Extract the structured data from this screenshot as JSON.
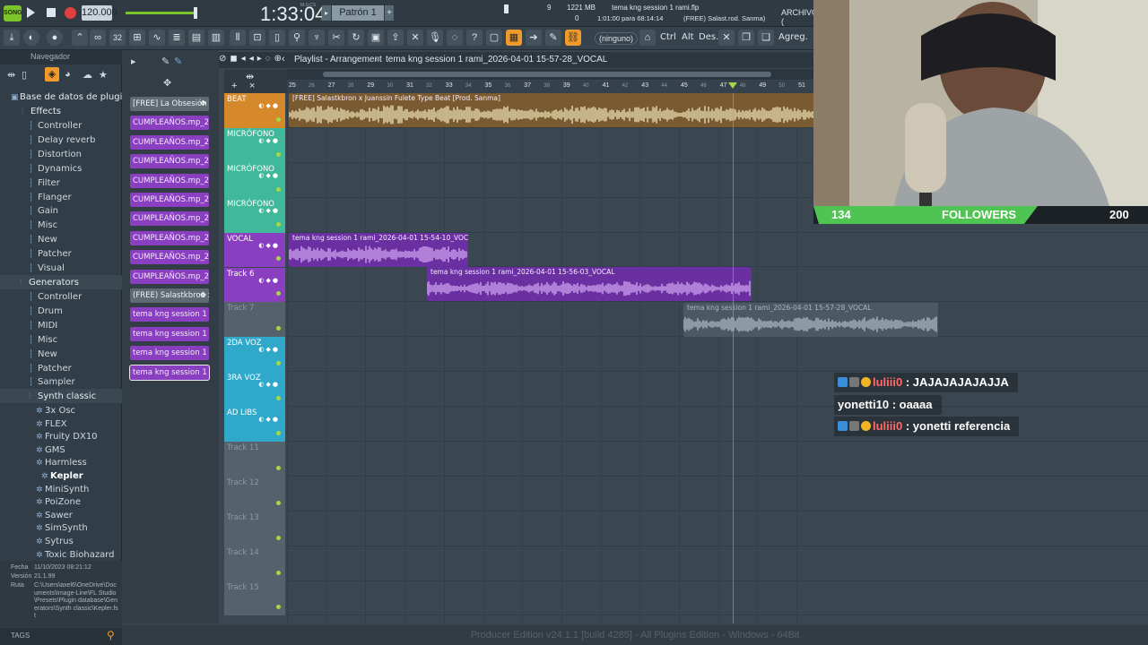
{
  "transport": {
    "tempo": "120.000",
    "time": "1:33:04",
    "time_label": "M:S:CS",
    "pattern": "Patrón 1",
    "cpu": "9",
    "memory": "1221 MB",
    "voices": "0",
    "project_file": "tema kng session 1 rami.flp",
    "hint_time": "1:01:00 para 68:14:14",
    "hint_beat": "(FREE) Salast.rod. Sanma)",
    "menu_archivo": "ARCHIVO ("
  },
  "toolbar": {
    "channel_select": "(ninguno)",
    "ctrl": "Ctrl",
    "alt": "Alt",
    "des": "Des.",
    "agreg": "Agreg."
  },
  "browser": {
    "title": "Navegador",
    "db_label": "Base de datos de plugins",
    "effects_label": "Effects",
    "effects": [
      "Controller",
      "Delay reverb",
      "Distortion",
      "Dynamics",
      "Filter",
      "Flanger",
      "Gain",
      "Misc",
      "New",
      "Patcher",
      "Visual"
    ],
    "generators_label": "Generators",
    "generators": [
      "Controller",
      "Drum",
      "MIDI",
      "Misc",
      "New",
      "Patcher",
      "Sampler"
    ],
    "synth_classic_label": "Synth classic",
    "synths": [
      "3x Osc",
      "FLEX",
      "Fruity DX10",
      "GMS",
      "Harmless",
      "Kepler",
      "MiniSynth",
      "PoiZone",
      "Sawer",
      "SimSynth",
      "Sytrus",
      "Toxic Biohazard"
    ],
    "info_fecha_label": "Fecha",
    "info_fecha": "11/10/2023 08:21:12",
    "info_version_label": "Versión",
    "info_version": "21.1.99",
    "info_ruta_label": "Ruta",
    "info_ruta": "C:\\Users\\axel6\\OneDrive\\Documents\\Image-Line\\FL Studio\\Presets\\Plugin database\\Generators\\Synth classic\\Kepler.fst",
    "tags_label": "TAGS"
  },
  "clips": [
    {
      "label": "[FREE] La Obsesión F..",
      "kind": "gray"
    },
    {
      "label": "CUMPLEAÑOS.mp_2026-0..",
      "kind": "purple"
    },
    {
      "label": "CUMPLEAÑOS.mp_2026-0..",
      "kind": "purple"
    },
    {
      "label": "CUMPLEAÑOS.mp_2026-0..",
      "kind": "purple"
    },
    {
      "label": "CUMPLEAÑOS.mp_2026-0..",
      "kind": "purple"
    },
    {
      "label": "CUMPLEAÑOS.mp_2026-0..",
      "kind": "purple"
    },
    {
      "label": "CUMPLEAÑOS.mp_2026-0..",
      "kind": "purple"
    },
    {
      "label": "CUMPLEAÑOS.mp_2026-0..",
      "kind": "purple"
    },
    {
      "label": "CUMPLEAÑOS.mp_2026-0..",
      "kind": "purple"
    },
    {
      "label": "CUMPLEAÑOS.mp_2026-0..",
      "kind": "purple"
    },
    {
      "label": "(FREE) Salastkbron x..",
      "kind": "gray"
    },
    {
      "label": "tema kng session 1 rami..",
      "kind": "purple"
    },
    {
      "label": "tema kng session 1 rami..",
      "kind": "purple"
    },
    {
      "label": "tema kng session 1 rami..",
      "kind": "purple"
    },
    {
      "label": "tema kng session 1 rami..",
      "kind": "purple"
    }
  ],
  "playlist": {
    "title": "Playlist - Arrangement",
    "arrangement": "tema kng session 1 rami_2026-04-01 15-57-28_VOCAL",
    "ruler": [
      "25",
      "27",
      "29",
      "31",
      "33",
      "35",
      "37",
      "39",
      "41",
      "43",
      "45",
      "47",
      "49",
      "51"
    ],
    "ruler_alt": [
      "26",
      "28",
      "30",
      "32",
      "34",
      "36",
      "38",
      "40",
      "42",
      "44",
      "46",
      "48",
      "50"
    ]
  },
  "tracks": [
    {
      "name": "BEAT",
      "color": "#d6892a"
    },
    {
      "name": "MICRÓFONO",
      "color": "#3fb99a"
    },
    {
      "name": "MICRÓFONO",
      "color": "#3fb99a"
    },
    {
      "name": "MICRÓFONO",
      "color": "#3fb99a"
    },
    {
      "name": "VOCAL",
      "color": "#8a3fc0"
    },
    {
      "name": "Track 6",
      "color": "#8a3fc0"
    },
    {
      "name": "Track 7",
      "color": "#55626b"
    },
    {
      "name": "2DA VOZ",
      "color": "#2fa8c9"
    },
    {
      "name": "3RA VOZ",
      "color": "#2fa8c9"
    },
    {
      "name": "AD LIBS",
      "color": "#2fa8c9"
    },
    {
      "name": "Track 11",
      "color": "#55626b"
    },
    {
      "name": "Track 12",
      "color": "#55626b"
    },
    {
      "name": "Track 13",
      "color": "#55626b"
    },
    {
      "name": "Track 14",
      "color": "#55626b"
    },
    {
      "name": "Track 15",
      "color": "#55626b"
    }
  ],
  "audio_clips": {
    "beat": "[FREE] Salastkbron x Juanssin Fulete  Type Beat  [Prod. Sanma]",
    "vocal1": "tema kng session 1 rami_2026-04-01 15-54-10_VOCAL",
    "vocal2": "tema kng session 1 rami_2026-04-01 15-56-03_VOCAL",
    "vocal3": "tema kng session 1 rami_2026-04-01 15-57-28_VOCAL"
  },
  "status": "Producer Edition v24.1.1 [build 4285] - All Plugins Edition - Windows - 64Bit",
  "stream": {
    "followers_current": "134",
    "followers_label": "FOLLOWERS",
    "followers_goal": "200",
    "followers_progress": 0.67
  },
  "chat": [
    {
      "user": "luliii0",
      "message": "JAJAJAJAJAJJA",
      "user_color": "#ff6b6b",
      "badges": true
    },
    {
      "user": "yonetti10",
      "message": "oaaaa",
      "user_color": "#ffffff",
      "badges": false
    },
    {
      "user": "luliii0",
      "message": "yonetti referencia",
      "user_color": "#ff6b6b",
      "badges": true
    }
  ]
}
